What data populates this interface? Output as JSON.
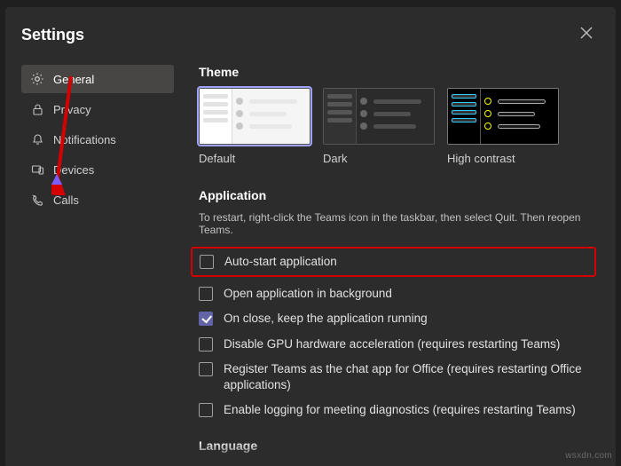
{
  "header": {
    "title": "Settings"
  },
  "sidebar": {
    "items": [
      {
        "label": "General"
      },
      {
        "label": "Privacy"
      },
      {
        "label": "Notifications"
      },
      {
        "label": "Devices"
      },
      {
        "label": "Calls"
      }
    ]
  },
  "theme": {
    "heading": "Theme",
    "options": [
      {
        "label": "Default"
      },
      {
        "label": "Dark"
      },
      {
        "label": "High contrast"
      }
    ]
  },
  "application": {
    "heading": "Application",
    "hint": "To restart, right-click the Teams icon in the taskbar, then select Quit. Then reopen Teams.",
    "opts": [
      {
        "label": "Auto-start application",
        "checked": false,
        "highlight": true
      },
      {
        "label": "Open application in background",
        "checked": false
      },
      {
        "label": "On close, keep the application running",
        "checked": true
      },
      {
        "label": "Disable GPU hardware acceleration (requires restarting Teams)",
        "checked": false
      },
      {
        "label": "Register Teams as the chat app for Office (requires restarting Office applications)",
        "checked": false
      },
      {
        "label": "Enable logging for meeting diagnostics (requires restarting Teams)",
        "checked": false
      }
    ]
  },
  "language": {
    "heading": "Language"
  },
  "watermark": "wsxdn.com"
}
